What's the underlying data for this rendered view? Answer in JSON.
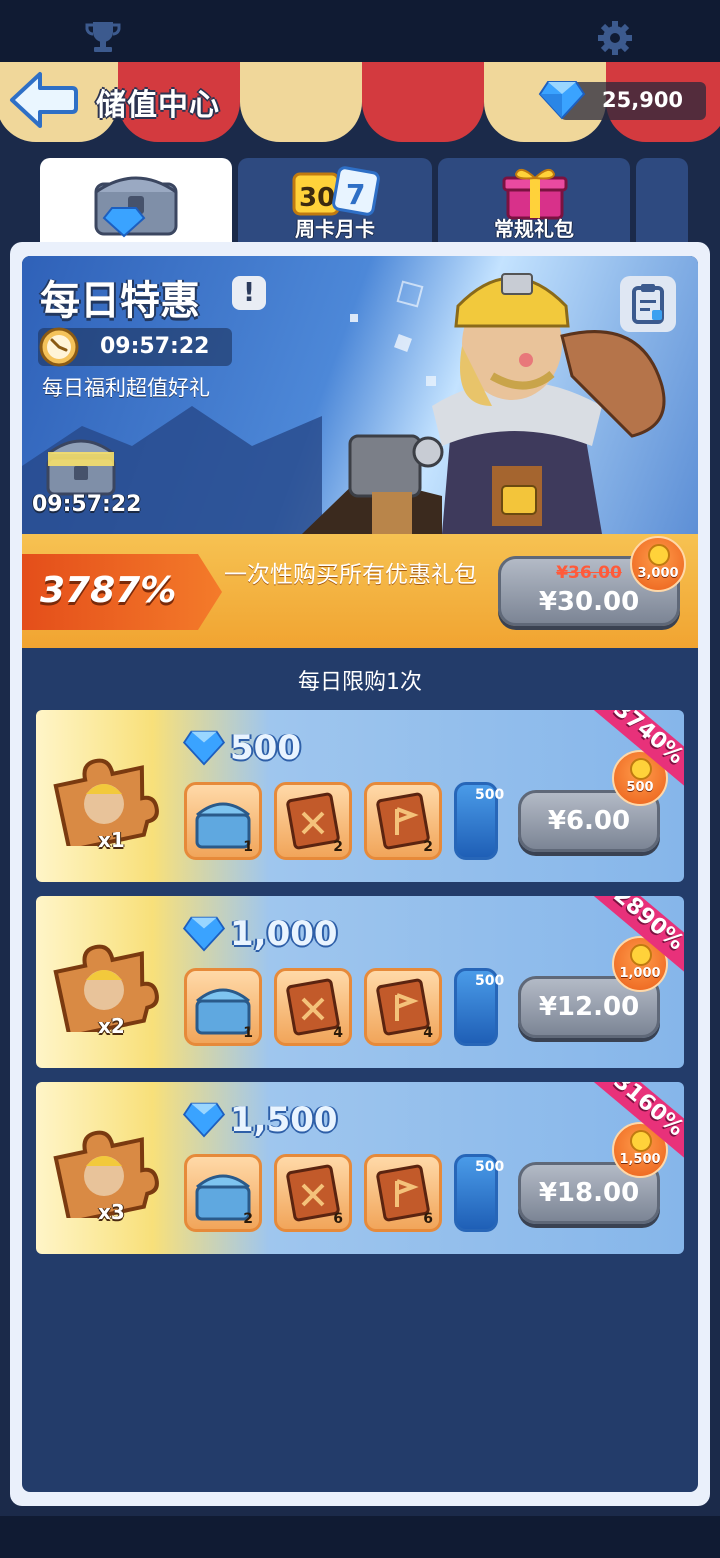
{
  "header": {
    "title": "储值中心",
    "gem_balance": "25,900"
  },
  "tabs": [
    {
      "label": "",
      "icon": "diamond-chest-icon",
      "active": true
    },
    {
      "label": "周卡月卡",
      "icon": "calendar-30-7-icon",
      "active": false
    },
    {
      "label": "常规礼包",
      "icon": "gift-box-icon",
      "active": false
    }
  ],
  "hero": {
    "title": "每日特惠",
    "info_badge": "!",
    "timer": "09:57:22",
    "subtitle": "每日福利超值好礼",
    "chest_timer": "09:57:22"
  },
  "bundle_all": {
    "percent": "3787%",
    "description": "一次性购买所有优惠礼包",
    "old_price": "¥36.00",
    "price": "¥30.00",
    "bonus_coins": "3,000"
  },
  "daily_limit": "每日限购1次",
  "offers": [
    {
      "multiplier": "x1",
      "gems": "500",
      "ribbon": "3740%",
      "price": "¥6.00",
      "bonus_coins": "500",
      "items": [
        {
          "icon": "blue-chest-icon",
          "count": "1"
        },
        {
          "icon": "blueprint-book-icon",
          "count": "2"
        },
        {
          "icon": "flag-book-icon",
          "count": "2"
        },
        {
          "icon": "exp-book-icon",
          "count": "500"
        }
      ]
    },
    {
      "multiplier": "x2",
      "gems": "1,000",
      "ribbon": "2890%",
      "price": "¥12.00",
      "bonus_coins": "1,000",
      "items": [
        {
          "icon": "blue-chest-icon",
          "count": "1"
        },
        {
          "icon": "blueprint-book-icon",
          "count": "4"
        },
        {
          "icon": "flag-book-icon",
          "count": "4"
        },
        {
          "icon": "exp-book-icon",
          "count": "500"
        }
      ]
    },
    {
      "multiplier": "x3",
      "gems": "1,500",
      "ribbon": "3160%",
      "price": "¥18.00",
      "bonus_coins": "1,500",
      "items": [
        {
          "icon": "blue-chest-icon",
          "count": "2"
        },
        {
          "icon": "blueprint-book-icon",
          "count": "6"
        },
        {
          "icon": "flag-book-icon",
          "count": "6"
        },
        {
          "icon": "exp-book-icon",
          "count": "500"
        }
      ]
    }
  ],
  "colors": {
    "background": "#1b2a4a",
    "awning_red": "#d33a3f",
    "awning_cream": "#f0d79a",
    "ribbon_pink": "#e8317a",
    "bundle_orange": "#f1a431"
  }
}
